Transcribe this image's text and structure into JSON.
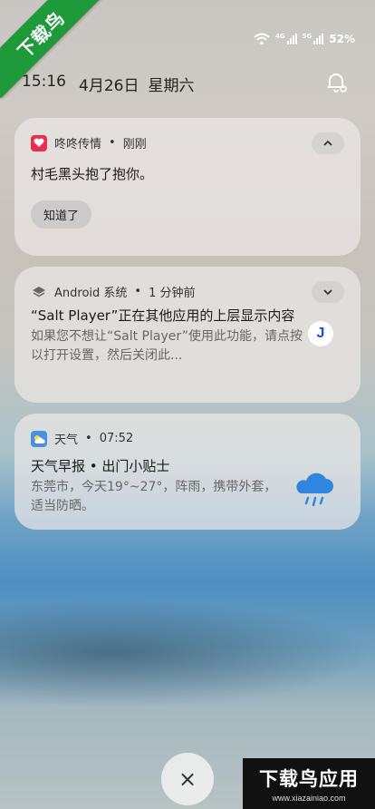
{
  "watermark": {
    "corner_text": "下载鸟",
    "bottom_title": "下载鸟应用",
    "bottom_url": "www.xiazainiao.com"
  },
  "status": {
    "net1_label": "4G",
    "net2_label": "5G",
    "battery": "52%"
  },
  "header": {
    "time": "15:16",
    "date": "4月26日",
    "weekday": "星期六"
  },
  "notifications": [
    {
      "app": "咚咚传情",
      "when": "刚刚",
      "title": "村毛黑头抱了抱你。",
      "action": "知道了",
      "icon": "heart-icon",
      "icon_color": "#e5314b"
    },
    {
      "app": "Android 系统",
      "when": "1 分钟前",
      "title": "“Salt Player”正在其他应用的上层显示内容",
      "text": "如果您不想让“Salt Player”使用此功能，请点按以打开设置，然后关闭此...",
      "badge": "J",
      "icon": "layers-icon"
    },
    {
      "app": "天气",
      "when": "07:52",
      "title": "天气早报 • 出门小贴士",
      "text": "东莞市，今天19°~27°，阵雨，携带外套，适当防晒。",
      "icon": "weather-icon",
      "icon_color": "#4a8fe3"
    }
  ],
  "separator": "•",
  "close_label": "×"
}
